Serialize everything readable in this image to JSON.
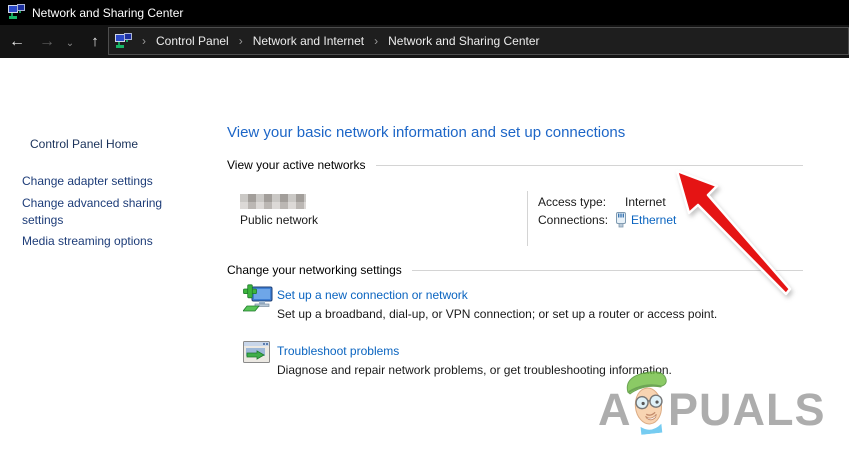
{
  "window": {
    "title": "Network and Sharing Center"
  },
  "icons": {
    "back": "←",
    "forward": "→",
    "dropdown": "⌄",
    "up": "↑",
    "chevron": "›"
  },
  "breadcrumb": {
    "items": [
      "Control Panel",
      "Network and Internet",
      "Network and Sharing Center"
    ]
  },
  "sidebar": {
    "home_label": "Control Panel Home",
    "links": [
      "Change adapter settings",
      "Change advanced sharing settings",
      "Media streaming options"
    ]
  },
  "main": {
    "heading": "View your basic network information and set up connections",
    "sections": {
      "active": "View your active networks",
      "settings": "Change your networking settings"
    },
    "network": {
      "type": "Public network",
      "access_label": "Access type:",
      "access_value": "Internet",
      "connections_label": "Connections:",
      "connection": "Ethernet"
    },
    "tasks": [
      {
        "title": "Set up a new connection or network",
        "desc": "Set up a broadband, dial-up, or VPN connection; or set up a router or access point."
      },
      {
        "title": "Troubleshoot problems",
        "desc": "Diagnose and repair network problems, or get troubleshooting information."
      }
    ]
  },
  "watermark": {
    "prefix": "A",
    "suffix": "PUALS"
  },
  "colors": {
    "titlebar_bg": "#000000",
    "toolbar_bg": "#141414",
    "heading_blue": "#1d66c7",
    "link_blue": "#0a64c0",
    "sidebar_home": "#19315a",
    "sidebar_link": "#1d3c78",
    "arrow_red": "#e51414"
  }
}
